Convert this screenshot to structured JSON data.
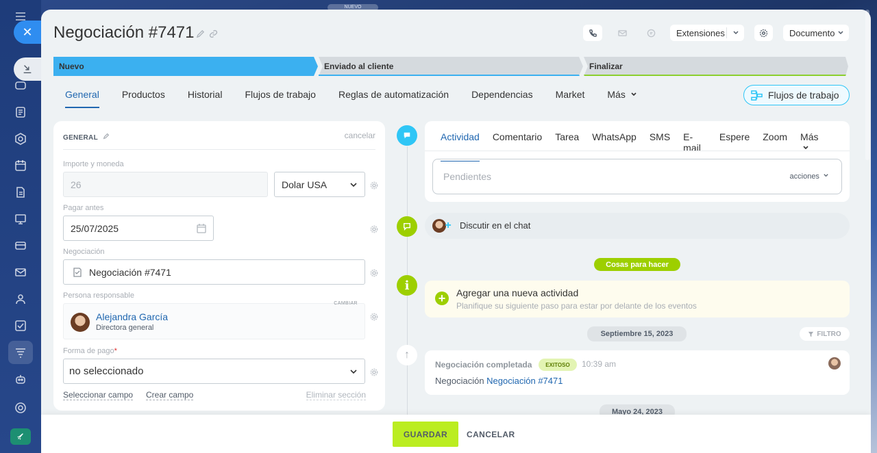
{
  "app": {
    "top_badge": "NUEVO"
  },
  "header": {
    "title": "Negociación #7471",
    "extensions_label": "Extensiones",
    "document_label": "Documento"
  },
  "stages": [
    {
      "label": "Nuevo",
      "color": "#3bb0f0"
    },
    {
      "label": "Enviado al cliente",
      "color": "#d5dade"
    },
    {
      "label": "Finalizar",
      "color": "#d5dade"
    }
  ],
  "tabs": [
    "General",
    "Productos",
    "Historial",
    "Flujos de trabajo",
    "Reglas de automatización",
    "Dependencias",
    "Market",
    "Más"
  ],
  "flow_button": "Flujos de trabajo",
  "form": {
    "section_title": "GENERAL",
    "cancel_label": "cancelar",
    "amount_label": "Importe y moneda",
    "amount_value": "26",
    "currency_value": "Dolar USA",
    "pay_before_label": "Pagar antes",
    "pay_before_value": "25/07/2025",
    "deal_label": "Negociación",
    "deal_value": "Negociación #7471",
    "responsible_label": "Persona responsable",
    "change_label": "CAMBIAR",
    "responsible_name": "Alejandra García",
    "responsible_role": "Directora general",
    "payment_label": "Forma de pago",
    "payment_value": "no seleccionado",
    "select_field": "Seleccionar campo",
    "create_field": "Crear campo",
    "delete_section": "Eliminar sección"
  },
  "activity": {
    "tabs": [
      "Actividad",
      "Comentario",
      "Tarea",
      "WhatsApp",
      "SMS",
      "E-mail",
      "Espere",
      "Zoom",
      "Más"
    ],
    "pending_placeholder": "Pendientes",
    "actions_label": "acciones",
    "chat_label": "Discutir en el chat",
    "todo_badge": "Cosas para hacer",
    "add_title": "Agregar una nueva actividad",
    "add_subtitle": "Planifique su siguiente paso para estar por delante de los eventos",
    "date1": "Septiembre 15, 2023",
    "filter_label": "FILTRO",
    "event_title": "Negociación completada",
    "event_badge": "EXITOSO",
    "event_time": "10:39 am",
    "event_text_prefix": "Negociación",
    "event_link": "Negociación #7471",
    "date2": "Mayo 24, 2023"
  },
  "footer": {
    "save_label": "GUARDAR",
    "cancel_label": "CANCELAR"
  }
}
